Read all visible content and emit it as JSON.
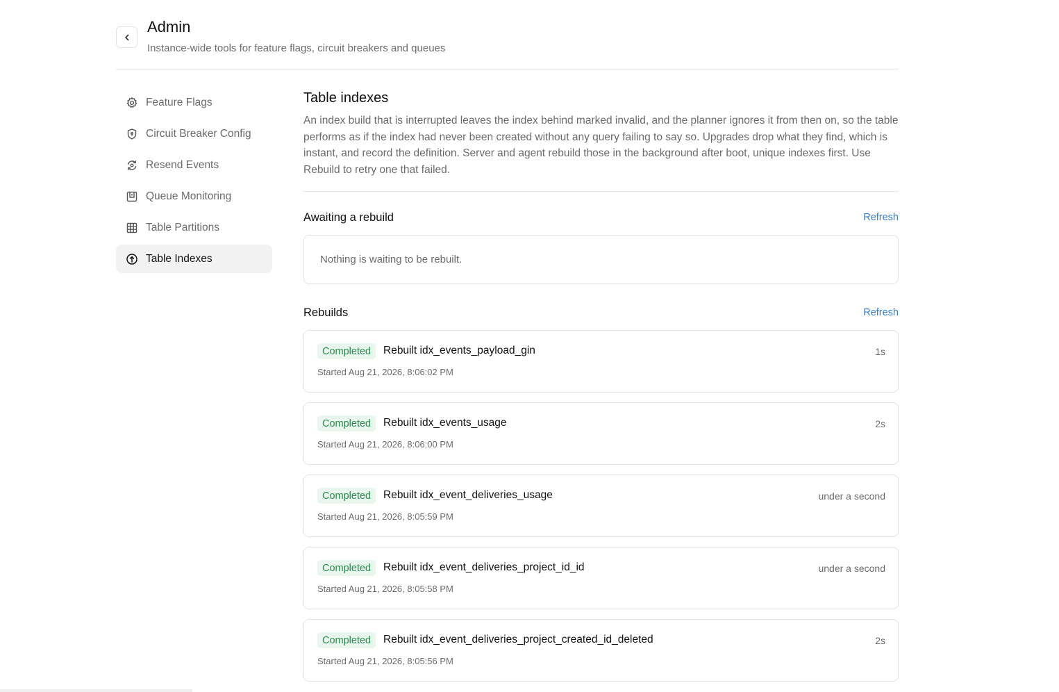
{
  "header": {
    "title": "Admin",
    "subtitle": "Instance-wide tools for feature flags, circuit breakers and queues",
    "back_icon": "chevron-left-icon"
  },
  "sidebar": {
    "items": [
      {
        "label": "Feature Flags",
        "icon": "gear-icon",
        "active": false
      },
      {
        "label": "Circuit Breaker Config",
        "icon": "shield-icon",
        "active": false
      },
      {
        "label": "Resend Events",
        "icon": "refresh-icon",
        "active": false
      },
      {
        "label": "Queue Monitoring",
        "icon": "queue-icon",
        "active": false
      },
      {
        "label": "Table Partitions",
        "icon": "grid-icon",
        "active": false
      },
      {
        "label": "Table Indexes",
        "icon": "index-icon",
        "active": true
      }
    ]
  },
  "main": {
    "title": "Table indexes",
    "description": "An index build that is interrupted leaves the index behind marked invalid, and the planner ignores it from then on, so the table performs as if the index had never been created without any query failing to say so. Upgrades drop what they find, which is instant, and record the definition. Server and agent rebuild those in the background after boot, unique indexes first. Use Rebuild to retry one that failed.",
    "awaiting": {
      "title": "Awaiting a rebuild",
      "refresh_label": "Refresh",
      "empty_text": "Nothing is waiting to be rebuilt."
    },
    "rebuilds": {
      "title": "Rebuilds",
      "refresh_label": "Refresh",
      "items": [
        {
          "status": "Completed",
          "title": "Rebuilt idx_events_payload_gin",
          "duration": "1s",
          "started": "Started Aug 21, 2026, 8:06:02 PM"
        },
        {
          "status": "Completed",
          "title": "Rebuilt idx_events_usage",
          "duration": "2s",
          "started": "Started Aug 21, 2026, 8:06:00 PM"
        },
        {
          "status": "Completed",
          "title": "Rebuilt idx_event_deliveries_usage",
          "duration": "under a second",
          "started": "Started Aug 21, 2026, 8:05:59 PM"
        },
        {
          "status": "Completed",
          "title": "Rebuilt idx_event_deliveries_project_id_id",
          "duration": "under a second",
          "started": "Started Aug 21, 2026, 8:05:58 PM"
        },
        {
          "status": "Completed",
          "title": "Rebuilt idx_event_deliveries_project_created_id_deleted",
          "duration": "2s",
          "started": "Started Aug 21, 2026, 8:05:56 PM"
        }
      ]
    }
  },
  "colors": {
    "accent": "#2f7fd6",
    "badge_bg": "#e8f6ee",
    "badge_text": "#2c8a52",
    "active_nav_bg": "#f2f2f2"
  }
}
